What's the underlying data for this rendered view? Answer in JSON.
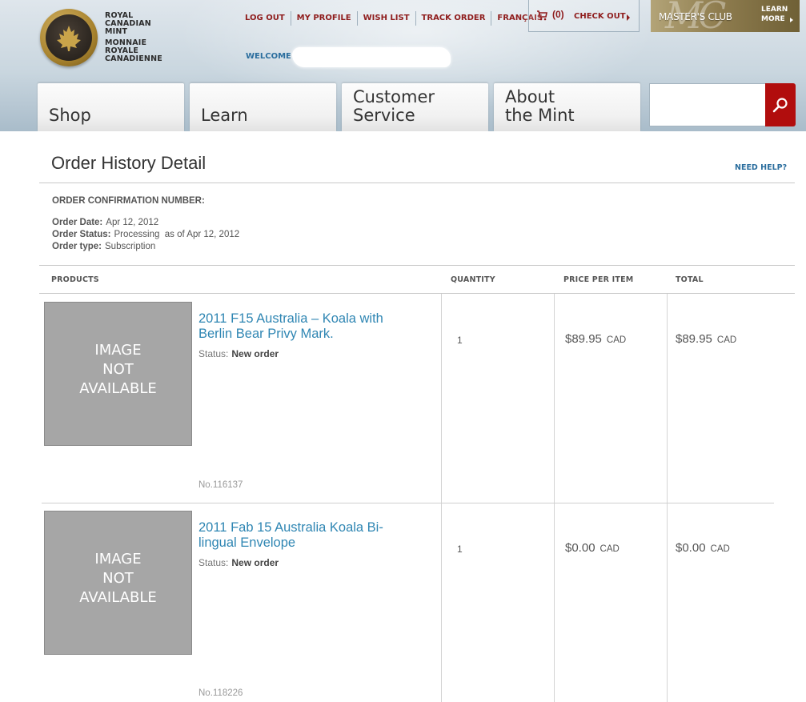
{
  "brand": {
    "name_en": [
      "Royal",
      "Canadian",
      "Mint"
    ],
    "name_fr": [
      "Monnaie",
      "Royale",
      "Canadienne"
    ]
  },
  "topnav": [
    "LOG OUT",
    "MY PROFILE",
    "WISH LIST",
    "TRACK ORDER",
    "FRANÇAIS"
  ],
  "cart": {
    "count": "(0)",
    "checkout": "CHECK OUT"
  },
  "welcome": "WELCOME",
  "masters_club": {
    "label": "MASTER'S CLUB",
    "learn1": "LEARN",
    "learn2": "MORE"
  },
  "tabs": [
    "Shop",
    "Learn",
    "Customer\nService",
    "About\nthe Mint"
  ],
  "search": {
    "placeholder": ""
  },
  "page": {
    "title": "Order History Detail",
    "need_help": "NEED HELP?",
    "confirmation_label": "ORDER CONFIRMATION NUMBER:",
    "order_date_label": "Order Date:",
    "order_date": "Apr 12, 2012",
    "order_status_label": "Order Status:",
    "order_status": "Processing  as of Apr 12, 2012",
    "order_type_label": "Order type:",
    "order_type": "Subscription"
  },
  "table": {
    "headers": [
      "PRODUCTS",
      "QUANTITY",
      "PRICE PER ITEM",
      "TOTAL"
    ],
    "rows": [
      {
        "image_text": "IMAGE\nNOT\nAVAILABLE",
        "name": "2011 F15 Australia – Koala with Berlin Bear Privy Mark.",
        "status_label": "Status:",
        "status": "New order",
        "number": "No.116137",
        "quantity": "1",
        "price": "$89.95",
        "price_currency": "CAD",
        "total": "$89.95",
        "total_currency": "CAD"
      },
      {
        "image_text": "IMAGE\nNOT\nAVAILABLE",
        "name": "2011 Fab 15 Australia Koala Bi-lingual Envelope",
        "status_label": "Status:",
        "status": "New order",
        "number": "No.118226",
        "quantity": "1",
        "price": "$0.00",
        "price_currency": "CAD",
        "total": "$0.00",
        "total_currency": "CAD"
      }
    ]
  },
  "colors": {
    "brand_red": "#8f1d1d",
    "link_blue": "#2f86b3",
    "search_red": "#b10d0d"
  }
}
